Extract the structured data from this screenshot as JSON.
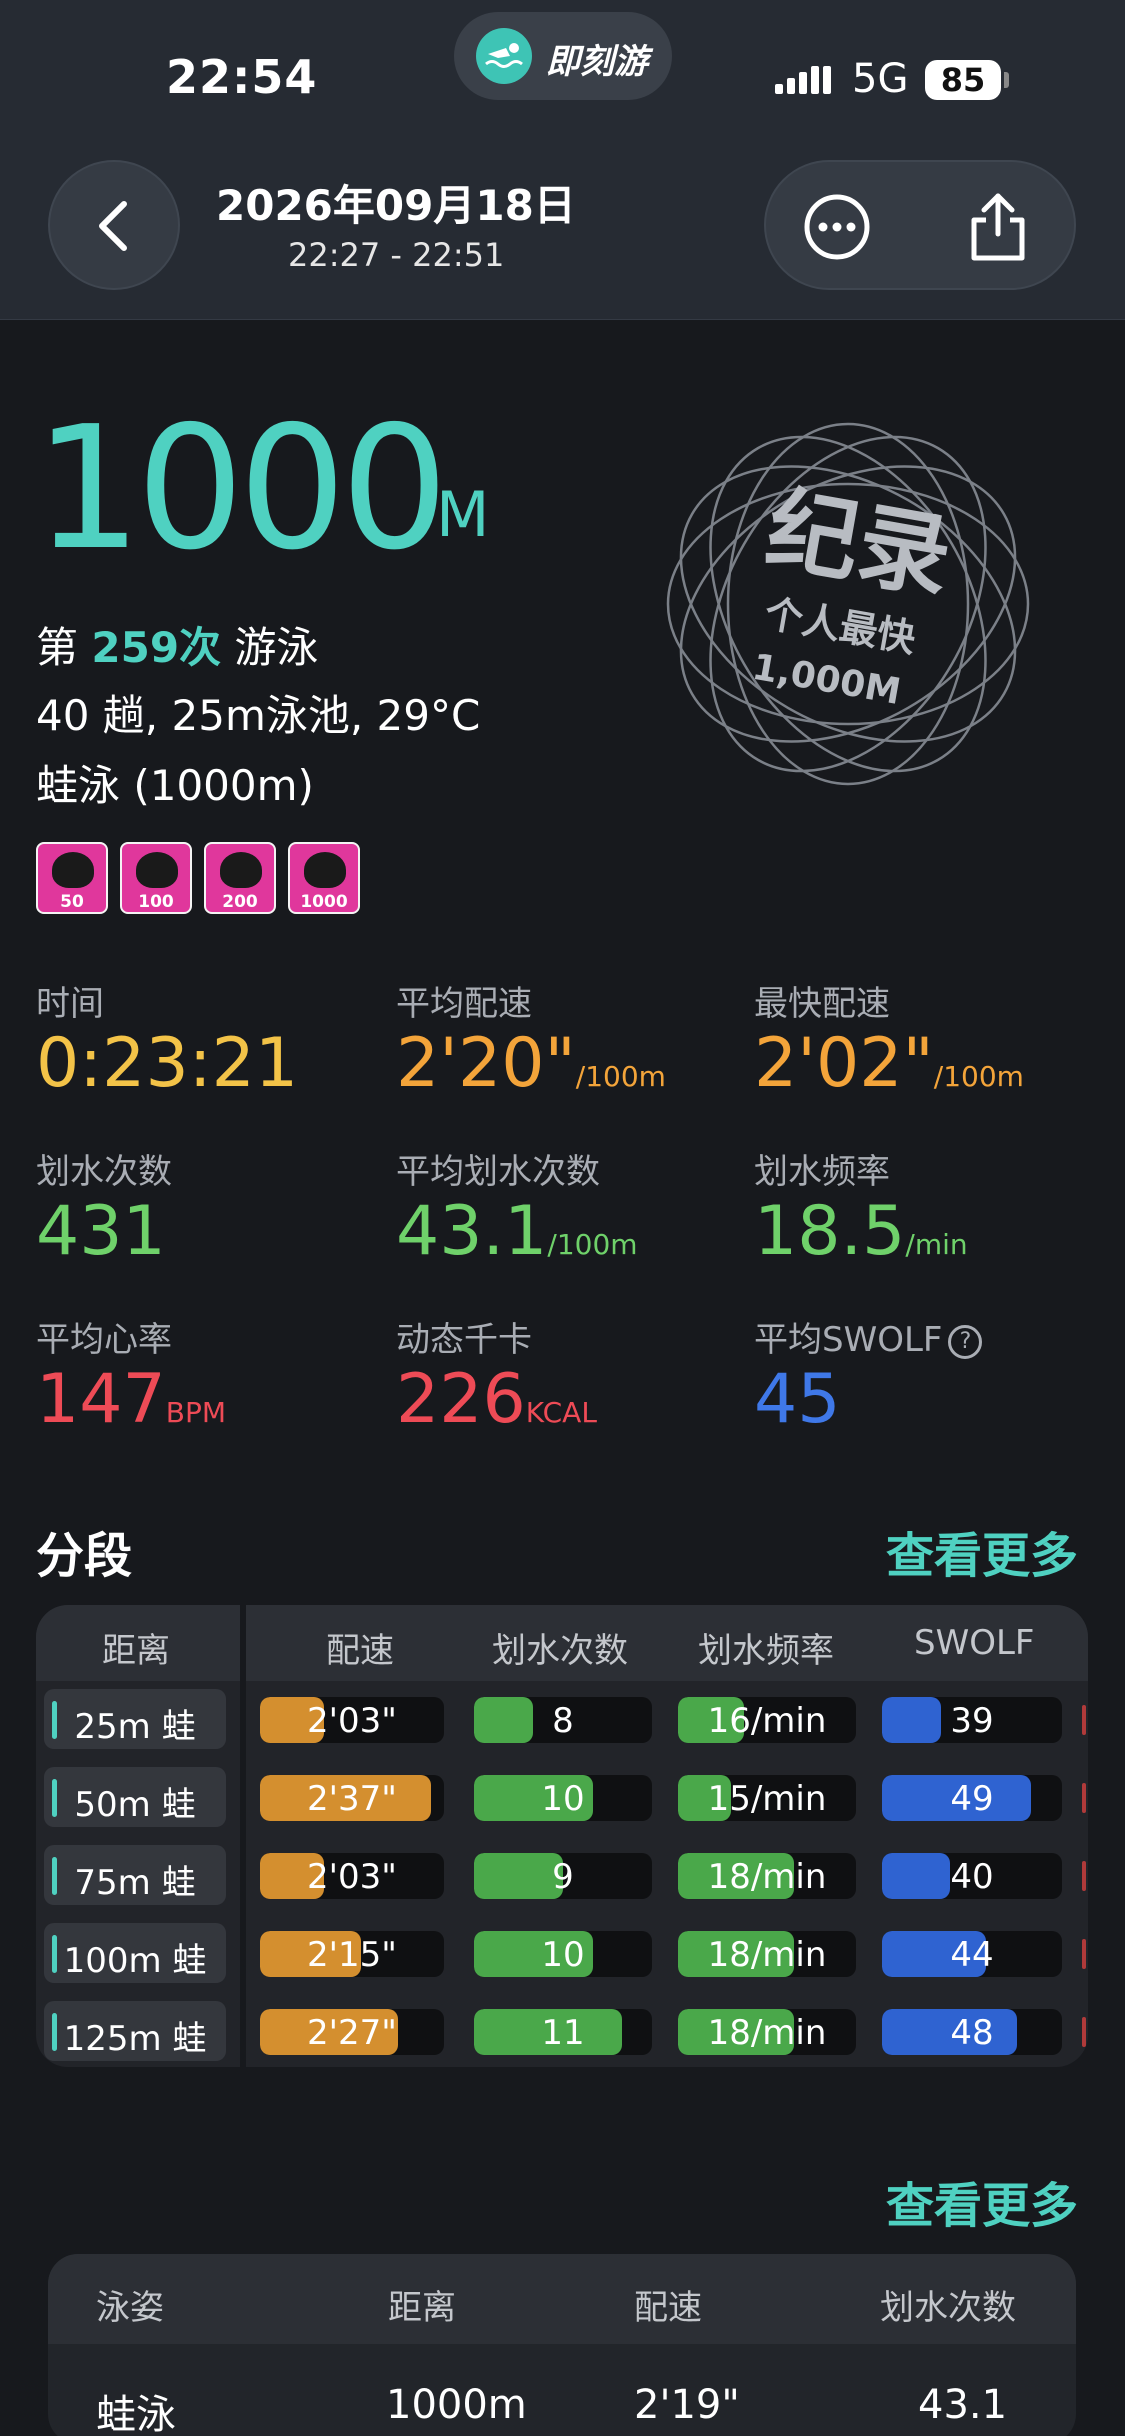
{
  "status_bar": {
    "time": "22:54",
    "network": "5G",
    "battery": "85"
  },
  "app": {
    "name": "即刻游",
    "logo_icon": "swimmer-icon",
    "accent": "#4fd1c1"
  },
  "header": {
    "date": "2026年09月18日",
    "time_range": "22:27 - 22:51"
  },
  "summary": {
    "distance": "1000",
    "distance_unit": "M",
    "session_prefix": "第",
    "session_count": "259次",
    "session_suffix": "游泳",
    "details": "40 趟, 25m泳池, 29°C",
    "stroke_summary": "蛙泳 (1000m)",
    "badges": [
      "50",
      "100",
      "200",
      "1000"
    ]
  },
  "record": {
    "title": "纪录",
    "subtitle": "个人最快",
    "distance": "1,000M"
  },
  "stats": [
    {
      "label": "时间",
      "value": "0:23:21",
      "unit": "",
      "color": "#f3c348"
    },
    {
      "label": "平均配速",
      "value": "2'20\"",
      "unit": "/100m",
      "color": "#f3a43a"
    },
    {
      "label": "最快配速",
      "value": "2'02\"",
      "unit": "/100m",
      "color": "#f3a43a"
    },
    {
      "label": "划水次数",
      "value": "431",
      "unit": "",
      "color": "#6fd16a"
    },
    {
      "label": "平均划水次数",
      "value": "43.1",
      "unit": "/100m",
      "color": "#6fd16a"
    },
    {
      "label": "划水频率",
      "value": "18.5",
      "unit": "/min",
      "color": "#6fd16a"
    },
    {
      "label": "平均心率",
      "value": "147",
      "unit": "BPM",
      "color": "#ee4b56"
    },
    {
      "label": "动态千卡",
      "value": "226",
      "unit": "KCAL",
      "color": "#ee4b56"
    },
    {
      "label": "平均SWOLF",
      "value": "45",
      "unit": "",
      "color": "#3f78e8"
    }
  ],
  "splits": {
    "title": "分段",
    "see_more": "查看更多",
    "headers": [
      "距离",
      "配速",
      "划水次数",
      "划水频率",
      "SWOLF"
    ],
    "rows": [
      {
        "distance": "25m 蛙",
        "pace": "2'03\"",
        "pace_fill": 0.35,
        "strokes": "8",
        "strokes_fill": 0.33,
        "rate": "16/min",
        "rate_fill": 0.37,
        "swolf": "39",
        "swolf_fill": 0.33
      },
      {
        "distance": "50m 蛙",
        "pace": "2'37\"",
        "pace_fill": 0.93,
        "strokes": "10",
        "strokes_fill": 0.67,
        "rate": "15/min",
        "rate_fill": 0.3,
        "swolf": "49",
        "swolf_fill": 0.83
      },
      {
        "distance": "75m 蛙",
        "pace": "2'03\"",
        "pace_fill": 0.35,
        "strokes": "9",
        "strokes_fill": 0.5,
        "rate": "18/min",
        "rate_fill": 0.65,
        "swolf": "40",
        "swolf_fill": 0.38
      },
      {
        "distance": "100m 蛙",
        "pace": "2'15\"",
        "pace_fill": 0.55,
        "strokes": "10",
        "strokes_fill": 0.67,
        "rate": "18/min",
        "rate_fill": 0.65,
        "swolf": "44",
        "swolf_fill": 0.58
      },
      {
        "distance": "125m 蛙",
        "pace": "2'27\"",
        "pace_fill": 0.75,
        "strokes": "11",
        "strokes_fill": 0.83,
        "rate": "18/min",
        "rate_fill": 0.65,
        "swolf": "48",
        "swolf_fill": 0.75
      }
    ]
  },
  "strokes": {
    "see_more": "查看更多",
    "headers": [
      "泳姿",
      "距离",
      "配速",
      "划水次数"
    ],
    "row": [
      "蛙泳",
      "1000m",
      "2'19\"",
      "43.1"
    ]
  }
}
